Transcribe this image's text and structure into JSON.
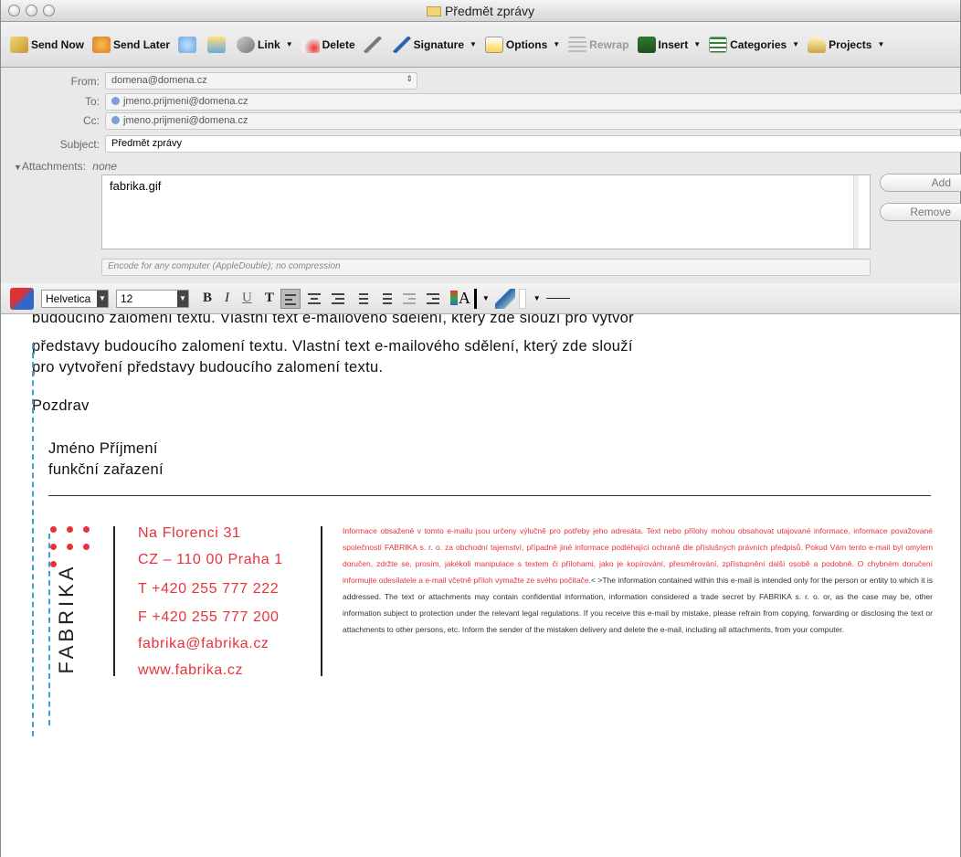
{
  "window": {
    "title": "Předmět zprávy"
  },
  "toolbar": {
    "items": [
      {
        "label": "Send Now",
        "icon": "send-now-icon"
      },
      {
        "label": "Send Later",
        "icon": "send-later-icon"
      },
      {
        "label": "",
        "icon": "address-book-icon"
      },
      {
        "label": "",
        "icon": "copy-icon"
      },
      {
        "label": "Link",
        "icon": "link-icon",
        "menu": true
      },
      {
        "label": "Delete",
        "icon": "delete-icon"
      },
      {
        "label": "",
        "icon": "attach-icon"
      },
      {
        "label": "Signature",
        "icon": "signature-icon",
        "menu": true
      },
      {
        "label": "Options",
        "icon": "options-icon",
        "menu": true
      },
      {
        "label": "Rewrap",
        "icon": "rewrap-icon",
        "disabled": true
      },
      {
        "label": "Insert",
        "icon": "insert-icon",
        "menu": true
      },
      {
        "label": "Categories",
        "icon": "categories-icon",
        "menu": true
      },
      {
        "label": "Projects",
        "icon": "projects-icon",
        "menu": true
      }
    ]
  },
  "headers": {
    "from_label": "From:",
    "from_value": "domena@domena.cz",
    "to_label": "To:",
    "to_value": "jmeno.prijmeni@domena.cz",
    "cc_label": "Cc:",
    "cc_value": "jmeno.prijmeni@domena.cz",
    "subject_label": "Subject:",
    "subject_value": "Předmět zprávy",
    "attachments_label": "Attachments:",
    "attachments_value": "none",
    "attachment_file": "fabrika.gif",
    "add_button": "Add",
    "remove_button": "Remove",
    "encoding": "Encode for any computer (AppleDouble); no compression"
  },
  "format": {
    "font": "Helvetica",
    "size": "12",
    "bold": "B",
    "italic": "I",
    "underline": "U",
    "plain": "T"
  },
  "body": {
    "line1": "budoucího zalomení textu. Vlastní text e-mailového sdělení, který zde slouží pro vytvoř",
    "line2": "představy budoucího zalomení textu. Vlastní text e-mailového sdělení, který zde slouží",
    "line3": "pro vytvoření představy budoucího zalomení textu.",
    "greeting": "Pozdrav",
    "name": "Jméno Příjmení",
    "position": "funkční zařazení"
  },
  "signature": {
    "brand": "FABRIKA",
    "address1": "Na Florenci 31",
    "address2": "CZ – 110 00 Praha 1",
    "phone": "T +420 255 777 222",
    "fax": "F +420 255 777 200",
    "email": "fabrika@fabrika.cz",
    "web": "www.fabrika.cz",
    "disclaimer_cz": "Informace obsažené v tomto e-mailu jsou určeny výlučně pro potřeby jeho adresáta. Text nebo přílohy mohou obsahovat utajované informace, informace považované společností FABRIKA s. r. o. za obchodní tajemství, případně jiné informace podléhající ochraně dle příslušných právních předpisů. Pokud Vám tento e-mail byl omylem doručen, zdržte se, prosím, jakékoli manipulace s textem či přílohami, jako je kopírování, přesměrování, zpřístupnění další osobě a podobně. O chybném doručení informujte odesílatele a e-mail včetně příloh vymažte ze svého počítače.",
    "disclaimer_en": "< >The information contained within this e-mail is intended only for the person or entity to which it is addressed. The text or attachments may contain confidential information, information considered a trade secret by FABRIKA s. r. o. or, as the case may be, other information subject to protection under the relevant legal regulations. If you receive this e-mail by mistake, please refrain from copying, forwarding or disclosing the text or attachments to other persons, etc. Inform the sender of the mistaken delivery and delete the e-mail, including all attachments, from your computer."
  },
  "colors": {
    "accent": "#e8323a",
    "guide": "#3aa0d8"
  }
}
